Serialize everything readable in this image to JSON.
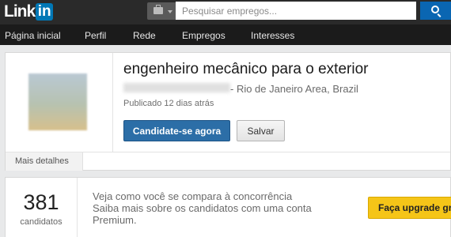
{
  "header": {
    "logo_text": "in",
    "search_placeholder": "Pesquisar empregos..."
  },
  "nav": {
    "items": [
      "Página inicial",
      "Perfil",
      "Rede",
      "Empregos",
      "Interesses"
    ]
  },
  "job": {
    "title": "engenheiro mecânico para o exterior",
    "location": "- Rio de Janeiro Area, Brazil",
    "posted": "Publicado 12 dias atrás",
    "apply_label": "Candidate-se agora",
    "save_label": "Salvar",
    "more_details": "Mais detalhes"
  },
  "applicants": {
    "count": "381",
    "count_label": "candidatos",
    "line1": "Veja como você se compara à concorrência",
    "line2": "Saiba mais sobre os candidatos com uma conta",
    "line3": "Premium.",
    "upgrade_label": "Faça upgrade gr"
  },
  "colors": {
    "topbar": "#2a2a2a",
    "nav": "#1b1b1b",
    "primary": "#2c6ea7",
    "upgrade": "#f5c518"
  }
}
